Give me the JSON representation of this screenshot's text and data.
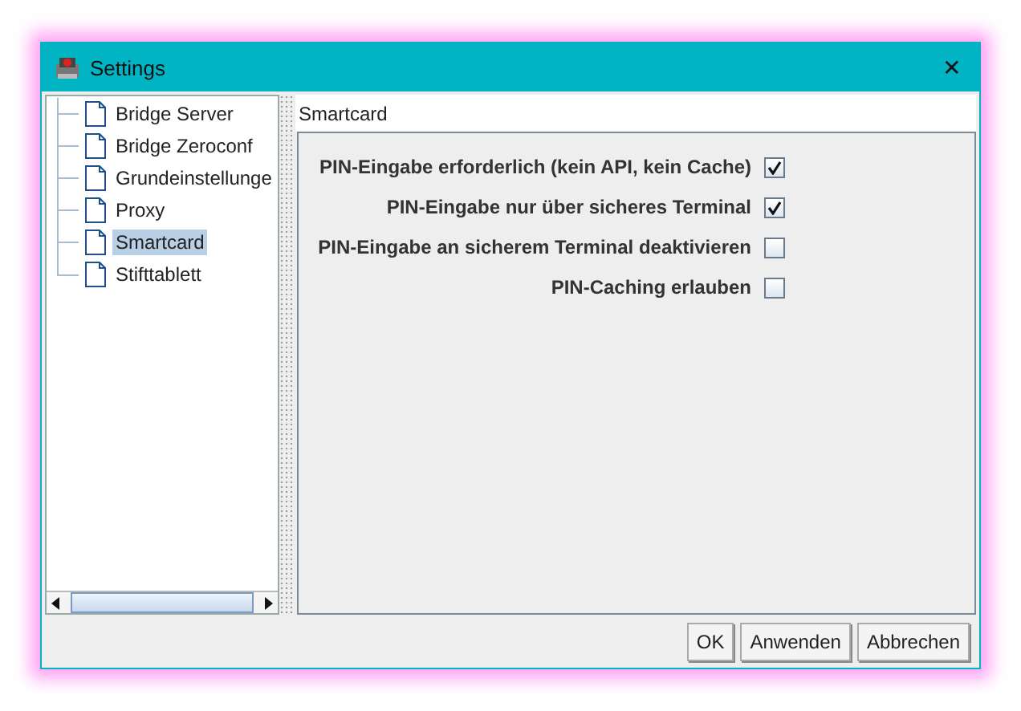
{
  "window": {
    "title": "Settings",
    "close": "✕"
  },
  "tree": {
    "items": [
      {
        "label": "Bridge Server",
        "selected": false
      },
      {
        "label": "Bridge Zeroconf",
        "selected": false
      },
      {
        "label": "Grundeinstellunge",
        "selected": false
      },
      {
        "label": "Proxy",
        "selected": false
      },
      {
        "label": "Smartcard",
        "selected": true
      },
      {
        "label": "Stifttablett",
        "selected": false
      }
    ]
  },
  "panel": {
    "title": "Smartcard",
    "options": [
      {
        "label": "PIN-Eingabe erforderlich (kein API, kein Cache)",
        "checked": true
      },
      {
        "label": "PIN-Eingabe nur über sicheres Terminal",
        "checked": true
      },
      {
        "label": "PIN-Eingabe an sicherem Terminal deaktivieren",
        "checked": false
      },
      {
        "label": "PIN-Caching erlauben",
        "checked": false
      }
    ]
  },
  "buttons": [
    "OK",
    "Anwenden",
    "Abbrechen"
  ]
}
